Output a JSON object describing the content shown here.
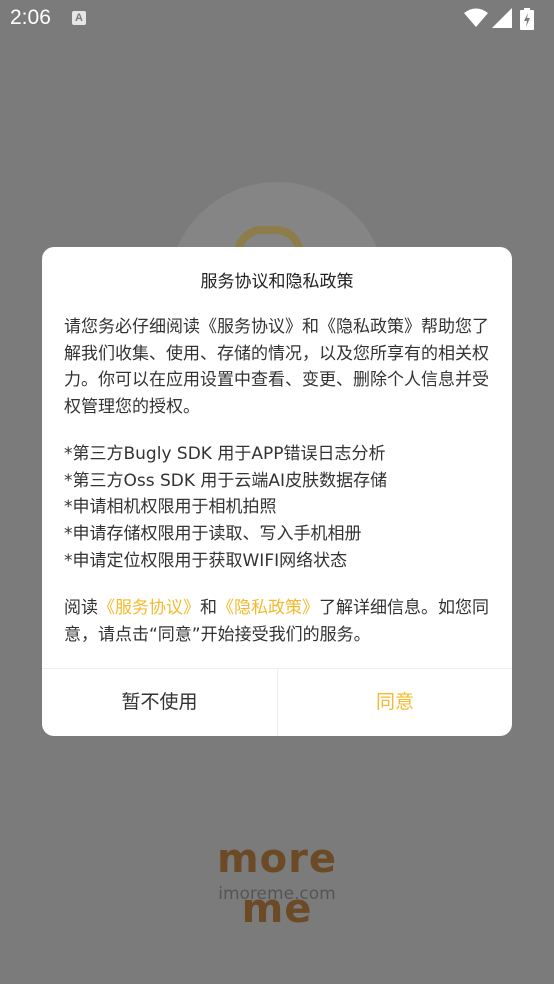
{
  "status_bar": {
    "time": "2:06",
    "notification_icon": "A",
    "icons": [
      "wifi-icon",
      "signal-icon",
      "battery-icon"
    ]
  },
  "dialog": {
    "title": "服务协议和隐私政策",
    "intro": "请您务必仔细阅读《服务协议》和《隐私政策》帮助您了解我们收集、使用、存储的情况，以及您所享有的相关权力。你可以在应用设置中查看、变更、删除个人信息并受权管理您的授权。",
    "permissions": [
      "*第三方Bugly SDK 用于APP错误日志分析",
      "*第三方Oss SDK 用于云端AI皮肤数据存储",
      "*申请相机权限用于相机拍照",
      "*申请存储权限用于读取、写入手机相册",
      "*申请定位权限用于获取WIFI网络状态"
    ],
    "footer_prefix": "阅读",
    "service_link": "《服务协议》",
    "footer_and": "和",
    "privacy_link": "《隐私政策》",
    "footer_suffix": "了解详细信息。如您同意，请点击“同意”开始接受我们的服务。",
    "decline_label": "暂不使用",
    "agree_label": "同意"
  },
  "brand": {
    "logo": "more me",
    "domain": "imoreme.com"
  },
  "colors": {
    "accent": "#f3ba2d",
    "overlay": "#7b7b7b",
    "brand": "#6b4a25"
  }
}
